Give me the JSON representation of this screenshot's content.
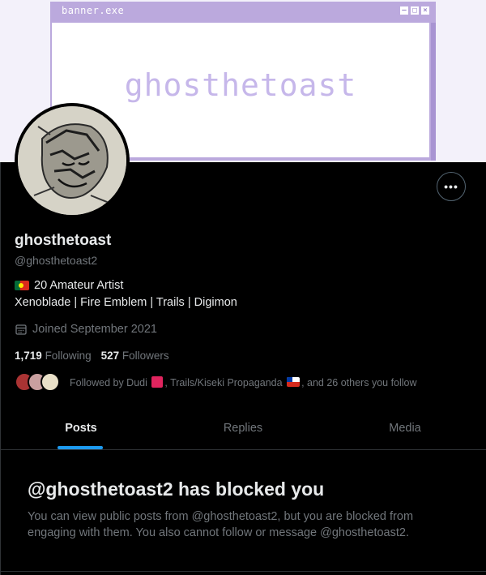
{
  "banner": {
    "window_title": "banner.exe",
    "text": "ghosthetoast",
    "buttons": [
      "–",
      "□",
      "×"
    ]
  },
  "profile": {
    "display_name": "ghosthetoast",
    "handle": "@ghosthetoast2",
    "bio_line1": "20 Amateur Artist",
    "bio_line2": "Xenoblade | Fire Emblem | Trails | Digimon",
    "joined": "Joined September 2021",
    "following_count": "1,719",
    "following_label": "Following",
    "followers_count": "527",
    "followers_label": "Followers",
    "followed_by_prefix": "Followed by Dudi",
    "followed_by_middle": ", Trails/Kiseki Propaganda",
    "followed_by_suffix": ", and 26 others you follow",
    "more_label": "•••"
  },
  "tabs": [
    {
      "label": "Posts",
      "active": true
    },
    {
      "label": "Replies",
      "active": false
    },
    {
      "label": "Media",
      "active": false
    }
  ],
  "blocked": {
    "title": "@ghosthetoast2 has blocked you",
    "description": "You can view public posts from @ghosthetoast2, but you are blocked from engaging with them. You also cannot follow or message @ghosthetoast2."
  },
  "colors": {
    "background": "#000000",
    "accent": "#1d9bf0",
    "muted_text": "#71767b",
    "banner_purple": "#bba9dd"
  }
}
